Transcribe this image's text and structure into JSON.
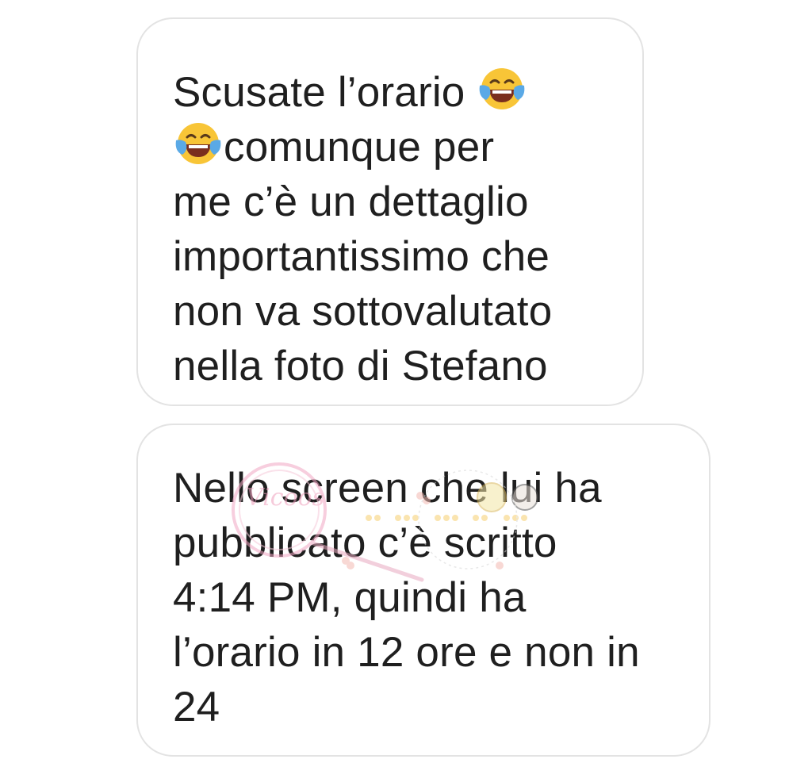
{
  "messages": [
    {
      "lines": [
        {
          "text": "Scusate l’orario ",
          "emoji_after": "face-with-tears-of-joy-icon"
        },
        {
          "emoji_before": "face-with-tears-of-joy-icon",
          "text": "comunque per"
        },
        {
          "text": "me c’è un dettaglio"
        },
        {
          "text": "importantissimo che"
        },
        {
          "text": "non va sottovalutato"
        },
        {
          "text": "nella foto di Stefano"
        }
      ]
    },
    {
      "lines": [
        {
          "text": "Nello screen che lui ha"
        },
        {
          "text": "pubblicato c’è scritto"
        },
        {
          "text": "4:14 PM, quindi ha"
        },
        {
          "text": "l’orario in 12 ore e non in"
        },
        {
          "text": "24"
        }
      ]
    }
  ],
  "watermark": {
    "text": "Vicoos",
    "icon": "magnifying-glass-watermark-icon"
  },
  "colors": {
    "text": "#1f1f1f",
    "bubble_border": "#e3e3e3",
    "background": "#ffffff"
  }
}
